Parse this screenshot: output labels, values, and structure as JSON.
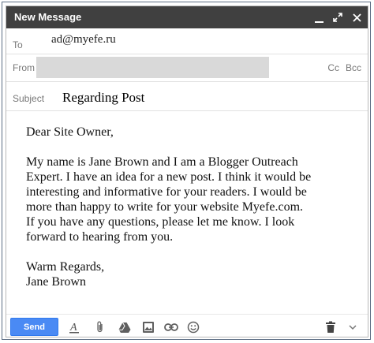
{
  "window": {
    "title": "New Message",
    "controls": [
      "minimize-icon",
      "expand-icon",
      "close-icon"
    ]
  },
  "recipients": {
    "to_label": "To",
    "to_value": "ad@myefe.ru",
    "from_label": "From",
    "cc_label": "Cc",
    "bcc_label": "Bcc"
  },
  "subject": {
    "label": "Subject",
    "value": "Regarding Post"
  },
  "body": {
    "greeting": "Dear Site Owner,",
    "paragraph": "My name is Jane Brown and I am a Blogger Outreach\nExpert. I have an idea for a new post. I think it would be\ninteresting and informative for your readers. I would be\nmore than happy to write for your website Myefe.com.\nIf you have any questions, please let me know. I look\nforward to hearing from you.",
    "closing": "Warm Regards,\nJane Brown"
  },
  "toolbar": {
    "send_label": "Send",
    "tools": [
      "format-text-icon",
      "attach-icon",
      "drive-icon",
      "photo-icon",
      "link-icon",
      "emoji-icon"
    ],
    "right_tools": [
      "trash-icon",
      "more-options-icon"
    ]
  },
  "colors": {
    "titlebar": "#404040",
    "send_button": "#4a8af4",
    "label_gray": "#777777",
    "from_redaction": "#d9d9d9"
  }
}
